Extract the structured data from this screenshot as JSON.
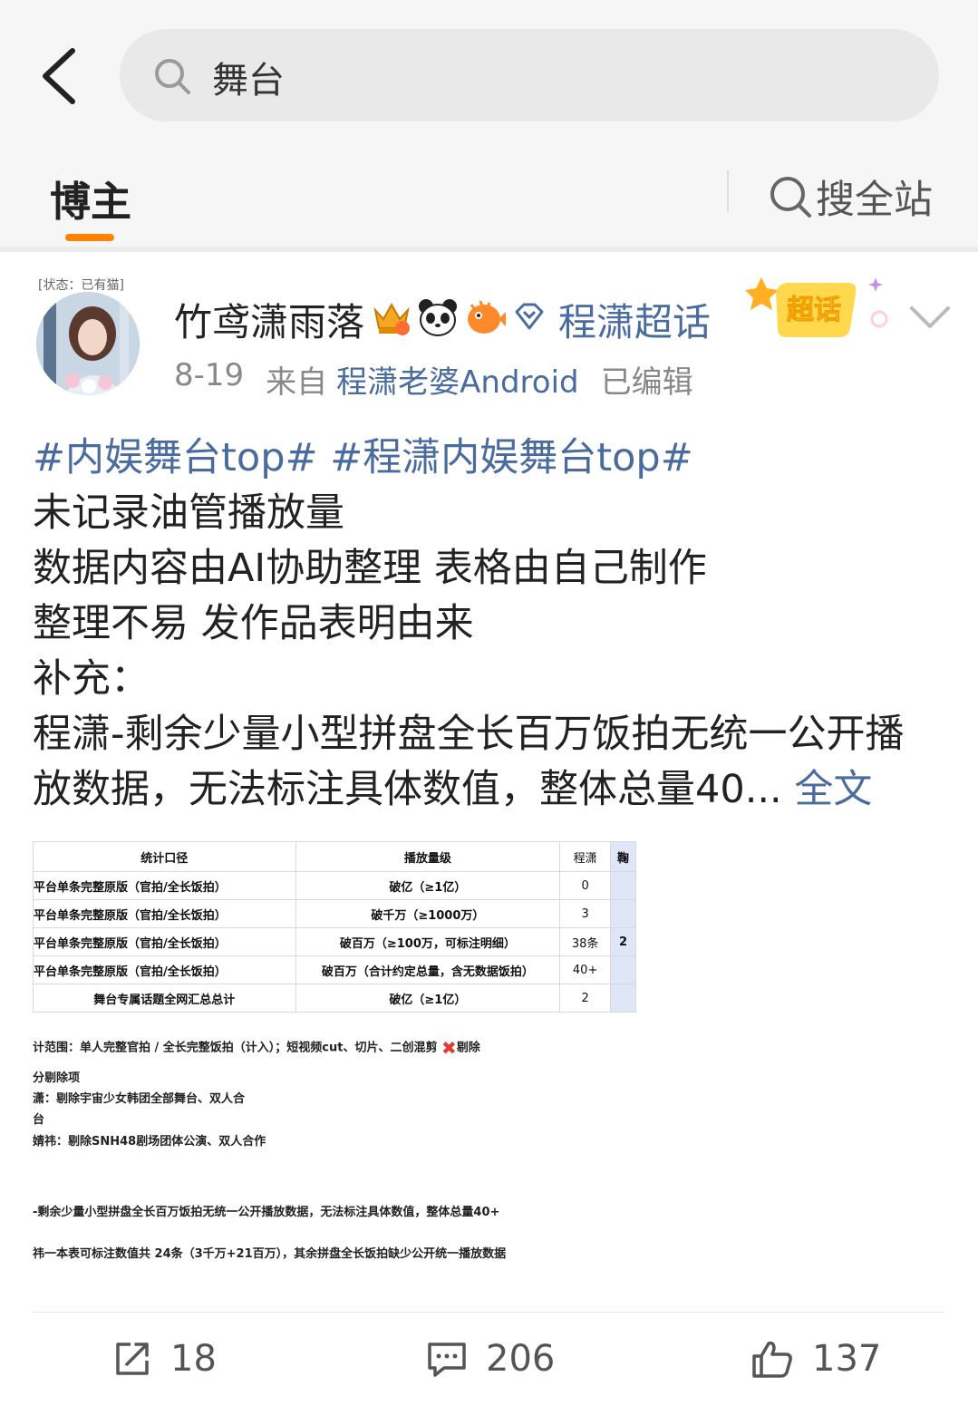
{
  "search": {
    "query": "舞台"
  },
  "tabs": {
    "bozhu": "博主",
    "search_all": "搜全站"
  },
  "post": {
    "avatar_badge": "[状态：已有猫]",
    "username": "竹鸢潇雨落",
    "topic_link": "程潇超话",
    "superhua_badge": "超话",
    "date": "8-19",
    "source_prefix": "来自",
    "source": "程潇老婆Android",
    "edited": "已编辑",
    "hashtag1": "#内娱舞台top#",
    "hashtag2": "#程潇内娱舞台top#",
    "lines": [
      "未记录油管播放量",
      "数据内容由AI协助整理 表格由自己制作",
      "整理不易 发作品表明由来",
      "补充：",
      "程潇-剩余少量小型拼盘全长百万饭拍无统一公开播",
      "放数据，无法标注具体数值，整体总量40..."
    ],
    "full_text": "全文",
    "image": {
      "headers": [
        "统计口径",
        "播放量级",
        "程潇",
        "鞠"
      ],
      "rows": [
        [
          "平台单条完整原版（官拍/全长饭拍）",
          "破亿（≥1亿）",
          "0",
          ""
        ],
        [
          "平台单条完整原版（官拍/全长饭拍）",
          "破千万（≥1000万）",
          "3",
          ""
        ],
        [
          "平台单条完整原版（官拍/全长饭拍）",
          "破百万（≥100万，可标注明细）",
          "38条",
          "2"
        ],
        [
          "平台单条完整原版（官拍/全长饭拍）",
          "破百万（合计约定总量，含无数据饭拍）",
          "40+",
          ""
        ],
        [
          "舞台专属话题全网汇总总计",
          "破亿（≥1亿）",
          "2",
          ""
        ]
      ],
      "notes": [
        "计范围：单人完整官拍 / 全长完整饭拍（计入）；短视频cut、切片、二创混剪",
        "剔除",
        "分剔除项",
        "潇：剔除宇宙少女韩团全部舞台、双人合",
        "台",
        "婧祎：剔除SNH48剧场团体公演、双人合作",
        "-剩余少量小型拼盘全长百万饭拍无统一公开播放数据，无法标注具体数值，整体总量40+",
        "祎一本表可标注数值共 24条（3千万+21百万），其余拼盘全长饭拍缺少公开统一播放数据"
      ]
    }
  },
  "actions": {
    "repost": "18",
    "comment": "206",
    "like": "137"
  },
  "colors": {
    "accent": "#ff8200",
    "link": "#4a6b9e",
    "search_bg": "#e9e9e9"
  }
}
